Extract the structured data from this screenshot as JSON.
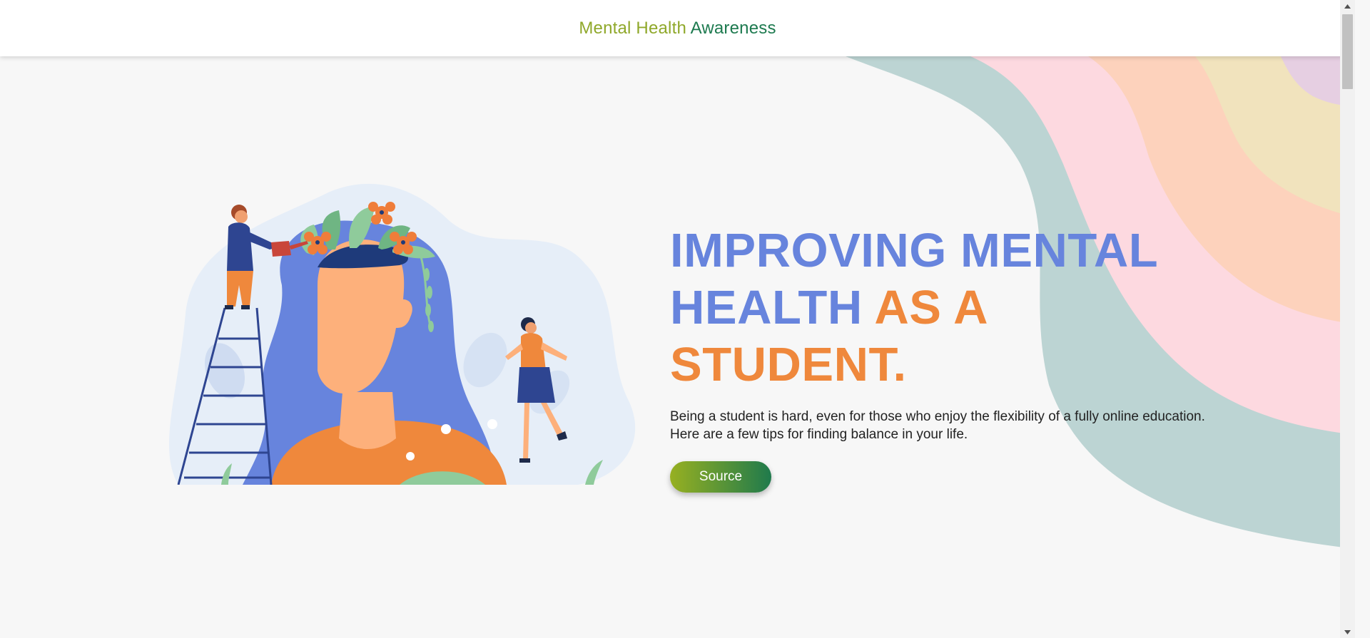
{
  "header": {
    "brand_part1": "Mental Health",
    "brand_part2": "Awareness"
  },
  "hero": {
    "headline_blue": "IMPROVING MENTAL HEALTH",
    "headline_orange": "AS A STUDENT.",
    "lead": "Being a student is hard, even for those who enjoy the flexibility of a fully online education. Here are a few tips for finding balance in your life.",
    "button_label": "Source",
    "illustration_icon": "person-head-with-flowers-illustration"
  },
  "colors": {
    "brand_green_light": "#8fa82a",
    "brand_green_dark": "#1d7a4f",
    "headline_blue": "#6784dd",
    "headline_orange": "#ef883c",
    "wave_teal": "#bcd4d3",
    "wave_pink": "#fdd9e0",
    "wave_peach": "#fdd2bc",
    "wave_yellow": "#f1e3bd",
    "wave_lilac": "#e6cfe2"
  }
}
